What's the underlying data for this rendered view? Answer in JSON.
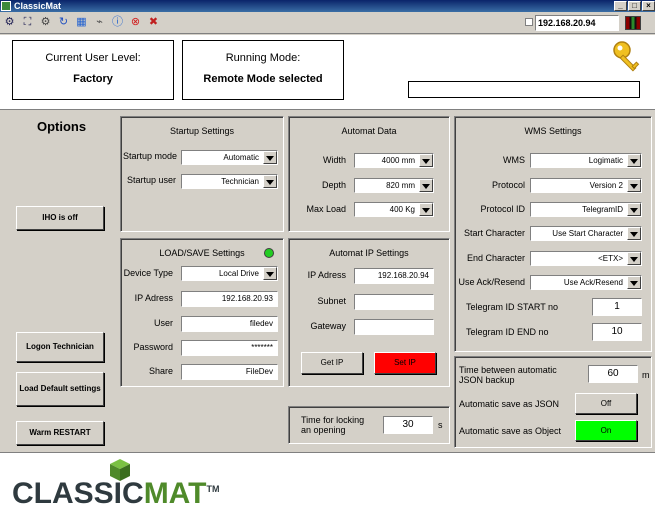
{
  "window": {
    "title": "ClassicMat"
  },
  "toolbar": {
    "ip_value": "192.168.20.94"
  },
  "header": {
    "user_level_label": "Current User Level:",
    "user_level_value": "Factory",
    "running_mode_label": "Running Mode:",
    "running_mode_value": "Remote Mode selected",
    "message_value": ""
  },
  "options": {
    "title": "Options",
    "iho_button": "IHO is off",
    "logon_button": "Logon Technician",
    "load_default_button": "Load Default settings",
    "warm_restart_button": "Warm RESTART"
  },
  "startup": {
    "title": "Startup Settings",
    "mode_label": "Startup mode",
    "mode_value": "Automatic",
    "user_label": "Startup user",
    "user_value": "Technician"
  },
  "load_save": {
    "title": "LOAD/SAVE Settings",
    "device_type_label": "Device Type",
    "device_type_value": "Local Drive",
    "ip_label": "IP Adress",
    "ip_value": "192.168.20.93",
    "user_label": "User",
    "user_value": "filedev",
    "password_label": "Password",
    "password_value": "*******",
    "share_label": "Share",
    "share_value": "FileDev",
    "status_color": "#22cc22"
  },
  "automat_data": {
    "title": "Automat Data",
    "width_label": "Width",
    "width_value": "4000 mm",
    "depth_label": "Depth",
    "depth_value": "820 mm",
    "maxload_label": "Max Load",
    "maxload_value": "400 Kg"
  },
  "automat_ip": {
    "title": "Automat IP Settings",
    "ip_label": "IP Adress",
    "ip_value": "192.168.20.94",
    "subnet_label": "Subnet",
    "subnet_value": "",
    "gateway_label": "Gateway",
    "gateway_value": "",
    "get_ip_button": "Get IP",
    "set_ip_button": "Set IP",
    "set_ip_color": "#ff0000"
  },
  "locking": {
    "label_line1": "Time for locking",
    "label_line2": "an opening",
    "value": "30",
    "unit": "s"
  },
  "wms": {
    "title": "WMS Settings",
    "wms_label": "WMS",
    "wms_value": "Logimatic",
    "protocol_label": "Protocol",
    "protocol_value": "Version 2",
    "protocol_id_label": "Protocol ID",
    "protocol_id_value": "TelegramID",
    "start_char_label": "Start Character",
    "start_char_value": "Use Start Character",
    "end_char_label": "End Character",
    "end_char_value": "<ETX>",
    "ack_label": "Use Ack/Resend",
    "ack_value": "Use Ack/Resend",
    "tel_start_label": "Telegram ID START no",
    "tel_start_value": "1",
    "tel_end_label": "Telegram ID END no",
    "tel_end_value": "10"
  },
  "json": {
    "backup_label_line1": "Time between automatic",
    "backup_label_line2": "JSON backup",
    "backup_value": "60",
    "backup_unit": "m",
    "save_json_label": "Automatic save as JSON",
    "save_json_button": "Off",
    "save_object_label": "Automatic save as Object",
    "save_object_button": "On",
    "on_color": "#00ff00"
  },
  "footer": {
    "logo_part1": "CLASSIC",
    "logo_part2": "MAT",
    "logo_tm": "TM",
    "logo_color1": "#2f3a3f",
    "logo_color2": "#4f8a2a"
  }
}
